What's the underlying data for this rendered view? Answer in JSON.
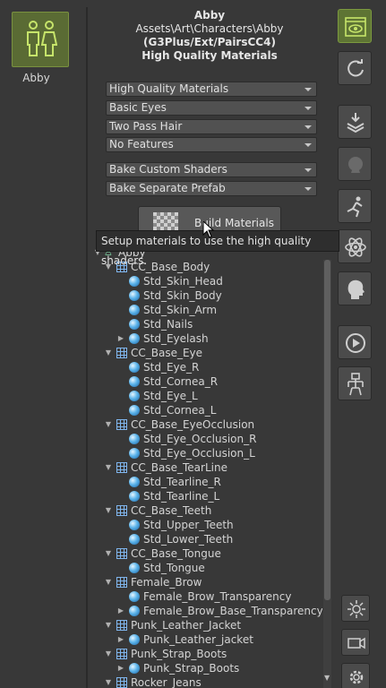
{
  "character": {
    "name": "Abby"
  },
  "header": {
    "name": "Abby",
    "path": "Assets\\Art\\Characters\\Abby",
    "generation": "(G3Plus/Ext/PairsCC4)",
    "quality": "High Quality Materials"
  },
  "dropdowns": [
    {
      "value": "High Quality Materials"
    },
    {
      "value": "Basic Eyes"
    },
    {
      "value": "Two Pass Hair"
    },
    {
      "value": "No Features"
    },
    {
      "value": "Bake Custom Shaders"
    },
    {
      "value": "Bake Separate Prefab"
    }
  ],
  "build_button": {
    "label": "Build Materials"
  },
  "tooltip": "Setup materials to use the high quality shaders.",
  "tree": [
    {
      "label": "Abby",
      "kind": "root"
    },
    {
      "label": "CC_Base_Body",
      "kind": "mesh"
    },
    {
      "label": "Std_Skin_Head",
      "kind": "mat"
    },
    {
      "label": "Std_Skin_Body",
      "kind": "mat"
    },
    {
      "label": "Std_Skin_Arm",
      "kind": "mat"
    },
    {
      "label": "Std_Nails",
      "kind": "mat"
    },
    {
      "label": "Std_Eyelash",
      "kind": "mat-collapsed"
    },
    {
      "label": "CC_Base_Eye",
      "kind": "mesh"
    },
    {
      "label": "Std_Eye_R",
      "kind": "mat"
    },
    {
      "label": "Std_Cornea_R",
      "kind": "mat"
    },
    {
      "label": "Std_Eye_L",
      "kind": "mat"
    },
    {
      "label": "Std_Cornea_L",
      "kind": "mat"
    },
    {
      "label": "CC_Base_EyeOcclusion",
      "kind": "mesh"
    },
    {
      "label": "Std_Eye_Occlusion_R",
      "kind": "mat"
    },
    {
      "label": "Std_Eye_Occlusion_L",
      "kind": "mat"
    },
    {
      "label": "CC_Base_TearLine",
      "kind": "mesh"
    },
    {
      "label": "Std_Tearline_R",
      "kind": "mat"
    },
    {
      "label": "Std_Tearline_L",
      "kind": "mat"
    },
    {
      "label": "CC_Base_Teeth",
      "kind": "mesh"
    },
    {
      "label": "Std_Upper_Teeth",
      "kind": "mat"
    },
    {
      "label": "Std_Lower_Teeth",
      "kind": "mat"
    },
    {
      "label": "CC_Base_Tongue",
      "kind": "mesh"
    },
    {
      "label": "Std_Tongue",
      "kind": "mat"
    },
    {
      "label": "Female_Brow",
      "kind": "mesh"
    },
    {
      "label": "Female_Brow_Transparency",
      "kind": "mat"
    },
    {
      "label": "Female_Brow_Base_Transparency",
      "kind": "mat-collapsed"
    },
    {
      "label": "Punk_Leather_Jacket",
      "kind": "mesh"
    },
    {
      "label": "Punk_Leather_jacket",
      "kind": "mat-collapsed"
    },
    {
      "label": "Punk_Strap_Boots",
      "kind": "mesh"
    },
    {
      "label": "Punk_Strap_Boots",
      "kind": "mat-collapsed"
    },
    {
      "label": "Rocker_Jeans",
      "kind": "mesh"
    }
  ],
  "toolbar": [
    {
      "icon": "eye-icon"
    },
    {
      "icon": "refresh-icon"
    },
    {
      "icon": "bake-icon"
    },
    {
      "icon": "character-dim-icon"
    },
    {
      "icon": "physics-pose-icon"
    },
    {
      "icon": "atom-icon"
    },
    {
      "icon": "head-icon"
    },
    {
      "icon": "play-icon"
    },
    {
      "icon": "skeleton-icon"
    },
    {
      "icon": "light-icon"
    },
    {
      "icon": "camera-icon"
    },
    {
      "icon": "settings-icon"
    }
  ],
  "colors": {
    "accent_green": "#5e7434",
    "tree_blue": "#5ab3ea"
  }
}
